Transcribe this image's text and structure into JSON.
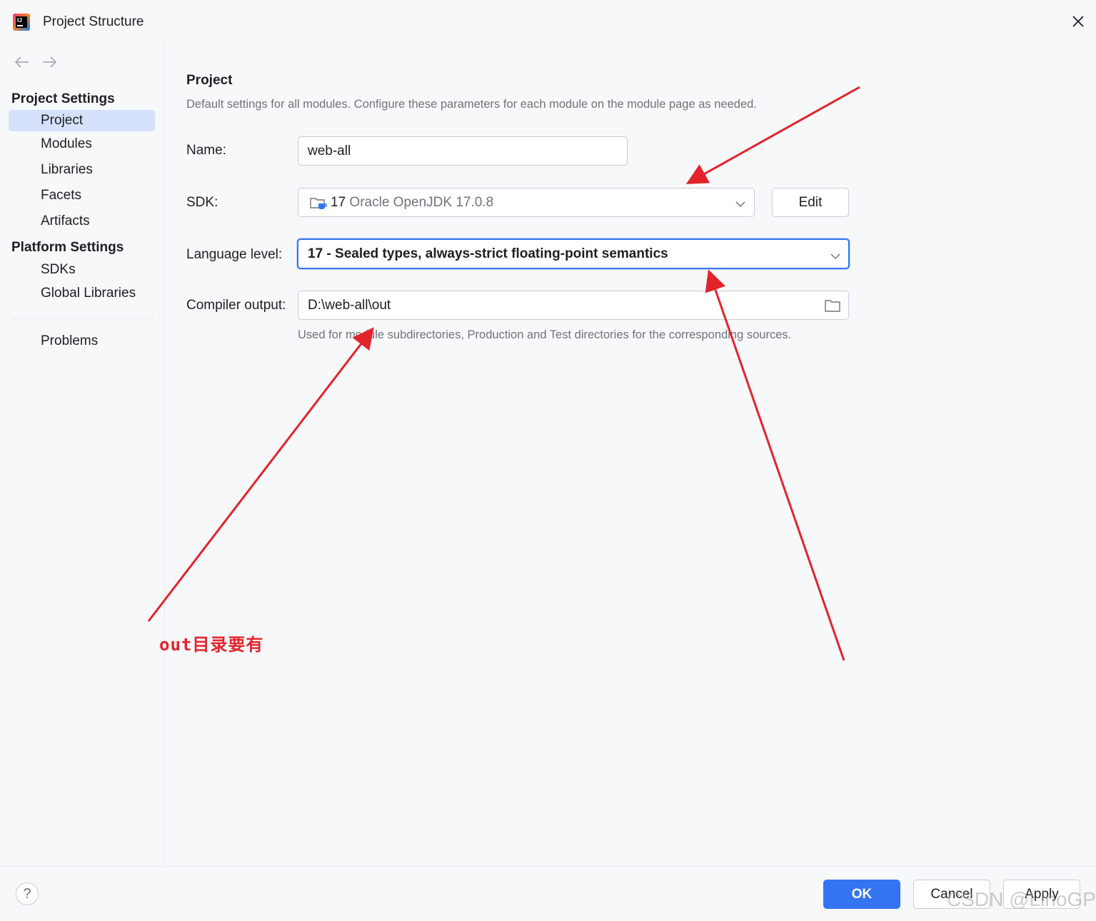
{
  "window": {
    "title": "Project Structure"
  },
  "nav": {
    "back": "←",
    "forward": "→"
  },
  "sidebar": {
    "project_settings_header": "Project Settings",
    "project_settings_items": [
      "Project",
      "Modules",
      "Libraries",
      "Facets",
      "Artifacts"
    ],
    "platform_settings_header": "Platform Settings",
    "platform_settings_items": [
      "SDKs",
      "Global Libraries"
    ],
    "problems": "Problems",
    "selected": "Project"
  },
  "panel": {
    "title": "Project",
    "description": "Default settings for all modules. Configure these parameters for each module on the module page as needed.",
    "name_label": "Name:",
    "name_value": "web-all",
    "sdk_label": "SDK:",
    "sdk_version": "17",
    "sdk_name": "Oracle OpenJDK 17.0.8",
    "edit_button": "Edit",
    "language_level_label": "Language level:",
    "language_level_value": "17 - Sealed types, always-strict floating-point semantics",
    "compiler_output_label": "Compiler output:",
    "compiler_output_value": "D:\\web-all\\out",
    "compiler_output_hint": "Used for module subdirectories, Production and Test directories for the corresponding sources."
  },
  "footer": {
    "help": "?",
    "ok": "OK",
    "cancel": "Cancel",
    "apply": "Apply"
  },
  "annotation": {
    "text": "out目录要有",
    "color": "#e3242b"
  },
  "watermark": "CSDN @LinoGP",
  "colors": {
    "accent": "#3574f0",
    "selection": "#d5e1fb",
    "annotation_red": "#e3242b"
  }
}
